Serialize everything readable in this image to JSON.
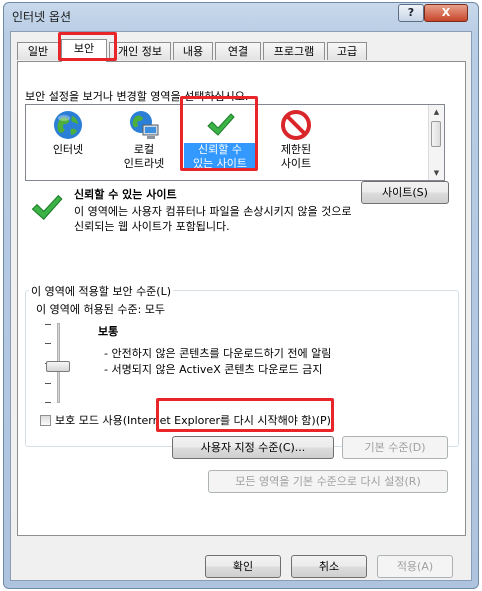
{
  "window": {
    "title": "인터넷 옵션",
    "help_label": "?",
    "close_label": "X"
  },
  "tabs": [
    {
      "label": "일반"
    },
    {
      "label": "보안"
    },
    {
      "label": "개인 정보"
    },
    {
      "label": "내용"
    },
    {
      "label": "연결"
    },
    {
      "label": "프로그램"
    },
    {
      "label": "고급"
    }
  ],
  "security": {
    "instruction": "보안 설정을 보거나 변경할 영역을 선택하십시오.",
    "zones": [
      {
        "label": "인터넷",
        "icon": "globe-icon"
      },
      {
        "label": "로컬\n인트라넷",
        "icon": "intranet-globe-icon"
      },
      {
        "label": "신뢰할 수\n있는 사이트",
        "icon": "green-checkmark-icon",
        "selected": true
      },
      {
        "label": "제한된\n사이트",
        "icon": "restricted-icon"
      }
    ],
    "zone_info": {
      "title": "신뢰할 수 있는 사이트",
      "description": "이 영역에는 사용자 컴퓨터나 파일을 손상시키지 않을 것으로 신뢰되는 웹 사이트가 포함됩니다.",
      "sites_button": "사이트(S)"
    },
    "level_group": {
      "legend": "이 영역에 적용할 보안 수준(L)",
      "allowed": "이 영역에 허용된 수준: 모두",
      "level_name": "보통",
      "bullets": [
        "- 안전하지 않은 콘텐츠를 다운로드하기 전에 알림",
        "- 서명되지 않은 ActiveX 콘텐츠 다운로드 금지"
      ],
      "protected_mode": "보호 모드 사용(Internet Explorer를 다시 시작해야 함)(P)",
      "custom_button": "사용자 지정 수준(C)...",
      "default_button": "기본 수준(D)"
    },
    "reset_all_button": "모든 영역을 기본 수준으로 다시 설정(R)"
  },
  "footer": {
    "ok": "확인",
    "cancel": "취소",
    "apply": "적용(A)"
  },
  "colors": {
    "highlight": "#e8262a",
    "selection": "#3399ff"
  }
}
